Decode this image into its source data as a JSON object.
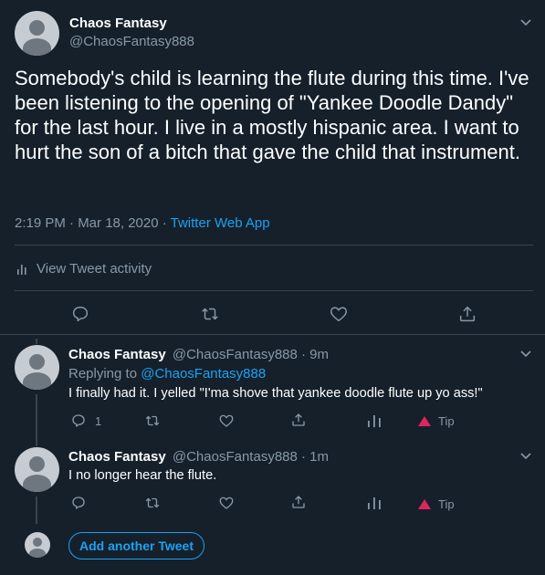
{
  "main_tweet": {
    "display_name": "Chaos Fantasy",
    "handle": "@ChaosFantasy888",
    "text": "Somebody's child is learning the flute during this time. I've been listening to the opening of \"Yankee Doodle Dandy\" for the last hour. I live in a mostly hispanic area. I want to hurt the son of a bitch that gave the child that instrument.",
    "timestamp": "2:19 PM · Mar 18, 2020 · ",
    "source": "Twitter Web App",
    "activity_label": "View Tweet activity",
    "actions": [
      "reply-icon",
      "retweet-icon",
      "like-icon",
      "share-icon"
    ]
  },
  "replies": [
    {
      "display_name": "Chaos Fantasy",
      "handle_time": "@ChaosFantasy888 · 9m",
      "replying_prefix": "Replying to ",
      "replying_to": "@ChaosFantasy888",
      "text": "I finally had it. I yelled \"I'ma shove that yankee doodle flute up yo ass!\"",
      "reply_count": "1",
      "tip_label": "Tip"
    },
    {
      "display_name": "Chaos Fantasy",
      "handle_time": "@ChaosFantasy888 · 1m",
      "text": "I no longer hear the flute.",
      "reply_count": "",
      "tip_label": "Tip"
    }
  ],
  "composer": {
    "add_tweet_label": "Add another Tweet"
  },
  "colors": {
    "background": "#15202b",
    "accent": "#1da1f2",
    "muted": "#8899a6",
    "divider": "#38444d",
    "tip": "#e0245e"
  }
}
